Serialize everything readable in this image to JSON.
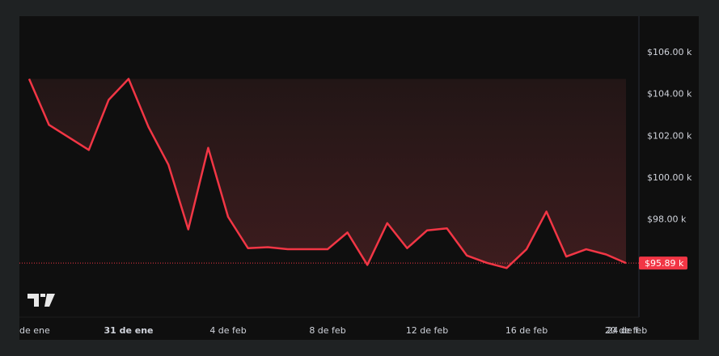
{
  "chart_data": {
    "type": "area",
    "x_labels": [
      "de ene",
      "31 de ene",
      "4 de feb",
      "8 de feb",
      "12 de feb",
      "16 de feb",
      "20 de feb",
      "24 de f"
    ],
    "x_label_index": [
      0,
      5,
      10,
      15,
      20,
      25,
      30,
      35
    ],
    "bold_labels": [
      "31 de ene"
    ],
    "values": [
      104700,
      102500,
      101900,
      101300,
      103700,
      104700,
      102400,
      100600,
      97500,
      101400,
      98100,
      96600,
      96650,
      96550,
      96550,
      96550,
      97350,
      95800,
      97800,
      96600,
      97450,
      97550,
      96250,
      95900,
      95650,
      96550,
      98350,
      96200,
      96550,
      96300,
      95890
    ],
    "y_ticks": [
      106000,
      104000,
      102000,
      100000,
      98000
    ],
    "y_tick_labels": [
      "$106.00 k",
      "$104.00 k",
      "$102.00 k",
      "$100.00 k",
      "$98.00 k"
    ],
    "ylim": [
      93300,
      107700
    ],
    "last_price": 95890,
    "last_price_label": "$95.89 k",
    "colors": {
      "line": "#f23645",
      "area_top": "#2a1717",
      "area_bottom": "#3a1c1d",
      "grid": "#2a2e39",
      "text": "#d1d4dc",
      "background": "#0f0f0f"
    },
    "logo": "tradingview-logo"
  }
}
